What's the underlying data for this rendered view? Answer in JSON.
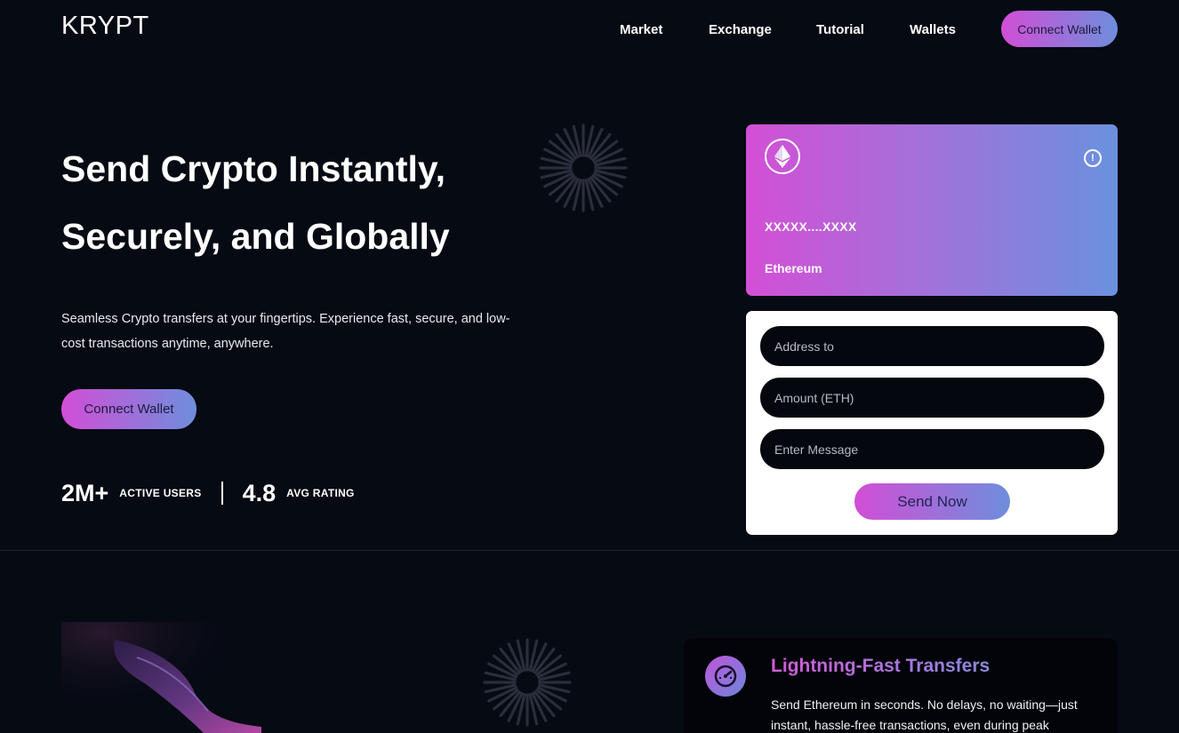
{
  "nav": {
    "logo": "KRYPT",
    "links": [
      "Market",
      "Exchange",
      "Tutorial",
      "Wallets"
    ],
    "connect_label": "Connect Wallet"
  },
  "hero": {
    "title_line1": "Send Crypto Instantly,",
    "title_line2": "Securely, and Globally",
    "subtitle": "Seamless Crypto transfers at your fingertips. Experience fast, secure, and low-cost transactions anytime, anywhere.",
    "cta_label": "Connect Wallet",
    "stats": [
      {
        "value": "2M+",
        "label": "ACTIVE USERS"
      },
      {
        "value": "4.8",
        "label": "AVG RATING"
      }
    ]
  },
  "card": {
    "address": "XXXXX....XXXX",
    "network": "Ethereum",
    "logo_icon": "ethereum-icon",
    "info_icon": "info-icon"
  },
  "form": {
    "address_placeholder": "Address to",
    "amount_placeholder": "Amount (ETH)",
    "message_placeholder": "Enter Message",
    "send_label": "Send Now"
  },
  "feature": {
    "icon": "speedometer-icon",
    "title": "Lightning-Fast Transfers",
    "text": "Send Ethereum in seconds. No delays, no waiting—just instant, hassle-free transactions, even during peak"
  },
  "colors": {
    "background": "#060a13",
    "gradient_start": "#d24ed6",
    "gradient_end": "#6e8edd"
  }
}
